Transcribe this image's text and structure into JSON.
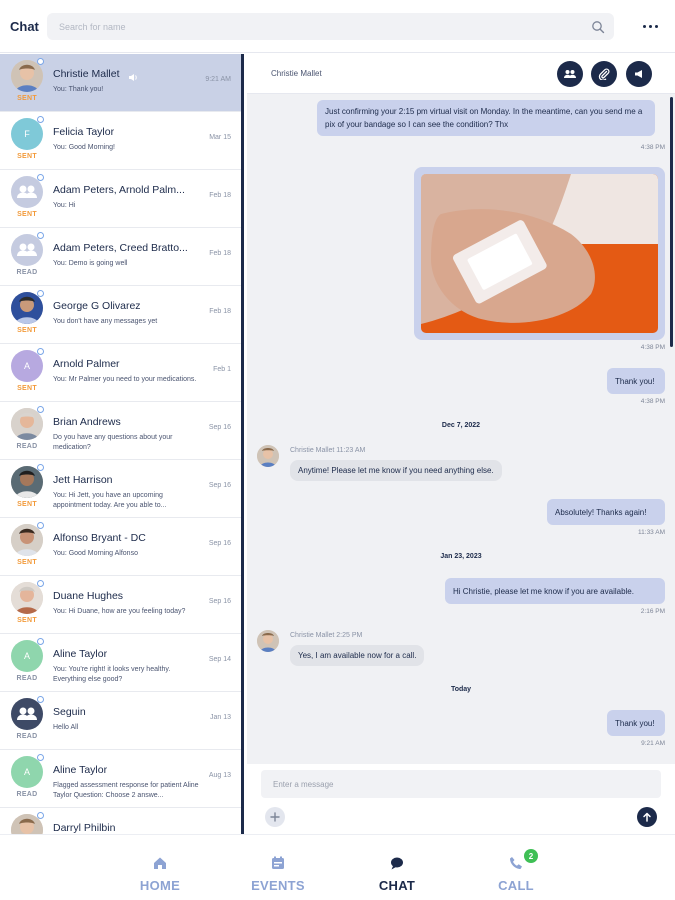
{
  "header": {
    "title": "Chat",
    "search_placeholder": "Search for name"
  },
  "conversations": [
    {
      "name": "Christie Mallet",
      "preview": "You: Thank you!",
      "date": "9:21 AM",
      "state": "SENT",
      "avatar": "photo",
      "muted": true,
      "selected": true
    },
    {
      "name": "Felicia Taylor",
      "preview": "You: Good Morning!",
      "date": "Mar 15",
      "state": "SENT",
      "avatar": "F"
    },
    {
      "name": "Adam Peters, Arnold Palm...",
      "preview": "You: Hi",
      "date": "Feb 18",
      "state": "SENT",
      "avatar": "group"
    },
    {
      "name": "Adam Peters, Creed Bratto...",
      "preview": "You: Demo is going well",
      "date": "Feb 18",
      "state": "READ",
      "avatar": "group"
    },
    {
      "name": "George G Olivarez",
      "preview": "You don't have any messages yet",
      "date": "Feb 18",
      "state": "SENT",
      "avatar": "photo"
    },
    {
      "name": "Arnold Palmer",
      "preview": "You: Mr Palmer you need to your medications.",
      "date": "Feb 1",
      "state": "SENT",
      "avatar": "A"
    },
    {
      "name": "Brian Andrews",
      "preview": "Do you have any questions about your medication?",
      "date": "Sep 16",
      "state": "READ",
      "avatar": "photo"
    },
    {
      "name": "Jett Harrison",
      "preview": "You: Hi Jett, you have an upcoming appointment today. Are you able to...",
      "date": "Sep 16",
      "state": "SENT",
      "avatar": "photo"
    },
    {
      "name": "Alfonso Bryant - DC",
      "preview": "You: Good Morning Alfonso",
      "date": "Sep 16",
      "state": "SENT",
      "avatar": "photo"
    },
    {
      "name": "Duane Hughes",
      "preview": "You: Hi Duane, how are you feeling today?",
      "date": "Sep 16",
      "state": "SENT",
      "avatar": "photo"
    },
    {
      "name": "Aline Taylor",
      "preview": "You: You're right! it looks very healthy. Everything else good?",
      "date": "Sep 14",
      "state": "READ",
      "avatar": "A"
    },
    {
      "name": "Seguin",
      "preview": "Hello All",
      "date": "Jan 13",
      "state": "READ",
      "avatar": "groupdark"
    },
    {
      "name": "Aline Taylor",
      "preview": "Flagged assessment response for patient Aline Taylor Question: Choose 2 answe...",
      "date": "Aug 13",
      "state": "READ",
      "avatar": "A"
    },
    {
      "name": "Darryl Philbin",
      "preview": "",
      "date": "",
      "state": "",
      "avatar": "photo"
    }
  ],
  "chat": {
    "contact_name": "Christie Mallet",
    "sender_name": "Christie Mallet",
    "messages": {
      "m1_text": "Just confirming your 2:15 pm virtual visit on Monday. In the meantime, can you send me a pix of your bandage so I can see the condition? Thx",
      "m1_time": "4:38 PM",
      "img_time": "4:38 PM",
      "m2_text": "Thank you!",
      "m2_time": "4:38 PM",
      "day1": "Dec 7, 2022",
      "in1_header": "Christie Mallet 11:23 AM",
      "in1_text": "Anytime! Please let me know if you need anything else.",
      "m3_text": "Absolutely! Thanks again!",
      "m3_time": "11:33 AM",
      "day2": "Jan 23, 2023",
      "m4_text": "Hi Christie, please let me know if you are available.",
      "m4_time": "2:16 PM",
      "in2_header": "Christie Mallet 2:25 PM",
      "in2_text": "Yes, I am available now for a call.",
      "day3": "Today",
      "m5_text": "Thank you!",
      "m5_time": "9:21 AM"
    },
    "input_placeholder": "Enter a message"
  },
  "nav": {
    "home": "HOME",
    "events": "EVENTS",
    "chat": "CHAT",
    "call": "CALL",
    "call_badge": "2",
    "active": "chat"
  },
  "colors": {
    "primary": "#1c2a4a",
    "selected_row": "#c9d1e6",
    "sent": "#f29a3a",
    "outgoing_bubble": "#c9d1ec",
    "nav_inactive": "#8da3d3",
    "badge": "#3fbf55"
  }
}
